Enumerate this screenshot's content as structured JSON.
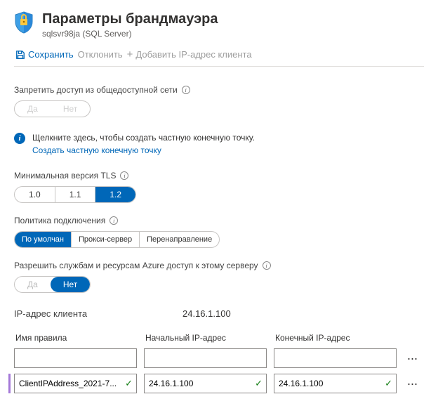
{
  "header": {
    "title": "Параметры брандмауэра",
    "subtitle": "sqlsvr98ja (SQL Server)"
  },
  "toolbar": {
    "save": "Сохранить",
    "discard": "Отклонить",
    "add_client": "Добавить IP-адрес клиента"
  },
  "public_access": {
    "label": "Запретить доступ из общедоступной сети",
    "yes": "Да",
    "no": "Нет"
  },
  "private_endpoint": {
    "message": "Щелкните здесь, чтобы создать частную конечную точку.",
    "link": "Создать частную конечную точку"
  },
  "tls": {
    "label": "Минимальная версия TLS",
    "v10": "1.0",
    "v11": "1.1",
    "v12": "1.2"
  },
  "conn_policy": {
    "label": "Политика подключения",
    "default": "По умолчан",
    "proxy": "Прокси-сервер",
    "redirect": "Перенаправление"
  },
  "azure_access": {
    "label": "Разрешить службам и ресурсам Azure доступ к этому серверу",
    "yes": "Да",
    "no": "Нет"
  },
  "client_ip": {
    "label": "IP-адрес клиента",
    "value": "24.16.1.100"
  },
  "table": {
    "col_name": "Имя правила",
    "col_start": "Начальный IP-адрес",
    "col_end": "Конечный IP-адрес",
    "rows": [
      {
        "name": "",
        "start": "",
        "end": "",
        "valid": false
      },
      {
        "name": "ClientIPAddress_2021-7...",
        "start": "24.16.1.100",
        "end": "24.16.1.100",
        "valid": true
      }
    ]
  }
}
